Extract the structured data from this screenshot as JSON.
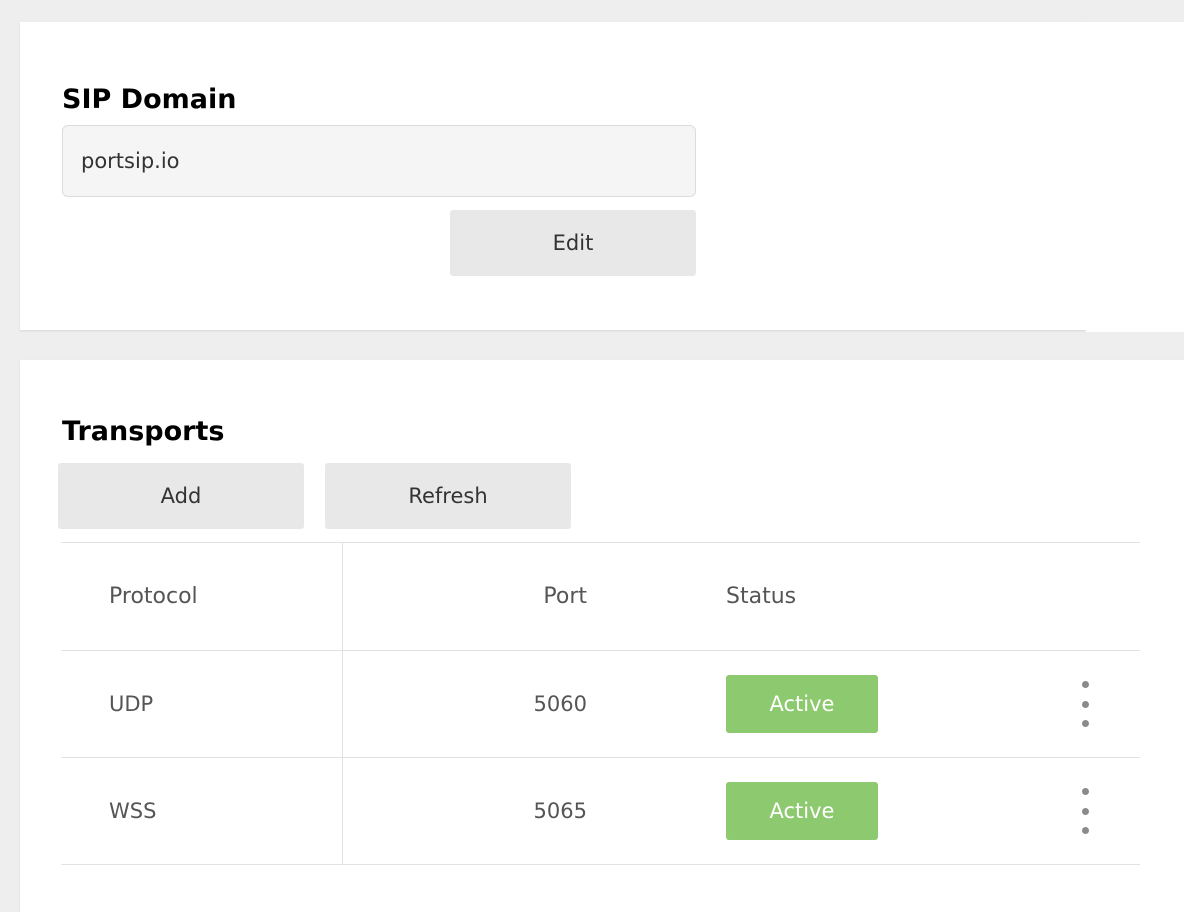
{
  "sip_domain": {
    "title": "SIP Domain",
    "value": "portsip.io",
    "edit_label": "Edit"
  },
  "transports": {
    "title": "Transports",
    "add_label": "Add",
    "refresh_label": "Refresh",
    "columns": {
      "protocol": "Protocol",
      "port": "Port",
      "status": "Status"
    },
    "rows": [
      {
        "protocol": "UDP",
        "port": "5060",
        "status": "Active"
      },
      {
        "protocol": "WSS",
        "port": "5065",
        "status": "Active"
      }
    ]
  },
  "colors": {
    "status_active": "#8dc96e",
    "button_bg": "#e8e8e8",
    "page_bg": "#eeeeee"
  },
  "icons": {
    "row_menu": "more-vertical-icon"
  }
}
